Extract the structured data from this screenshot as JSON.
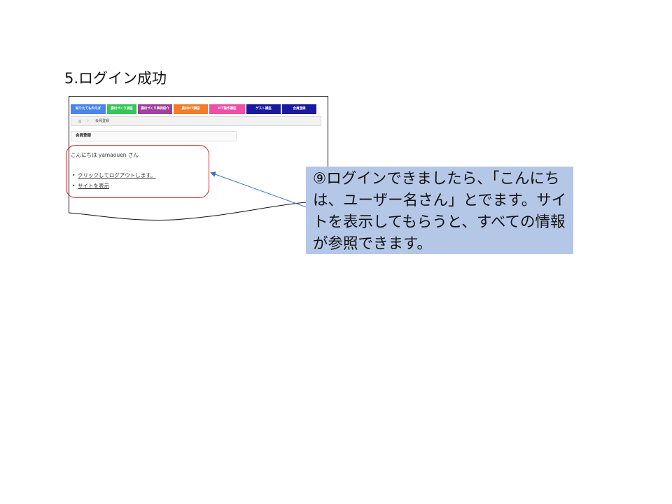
{
  "slide": {
    "title": "5.ログイン成功"
  },
  "screenshot": {
    "nav_tabs": [
      {
        "label": "知りたてものえば",
        "color": "#4a86e8"
      },
      {
        "label": "農村づくり講座",
        "color": "#34c759"
      },
      {
        "label": "農村づくり事例紹介",
        "color": "#a0419b"
      },
      {
        "label": "農村ICT講座",
        "color": "#f57c26"
      },
      {
        "label": "ICT操作講座",
        "color": "#ef4fa6"
      },
      {
        "label": "ゲスト講座",
        "color": "#1a1aa0"
      },
      {
        "label": "会員登録",
        "color": "#1a1aa0"
      }
    ],
    "breadcrumb": {
      "home_icon": "home-icon",
      "current": "会員登録"
    },
    "section_title": "会員登録",
    "greeting": "こんにちは yamaouen さん",
    "links": [
      {
        "label": "クリックしてログアウトします。"
      },
      {
        "label": "サイトを表示"
      }
    ]
  },
  "callout": {
    "text": "⑨ログインできましたら、「こんにちは、ユーザー名さん」とでます。サイトを表示してもらうと、すべての情報が参照できます。"
  },
  "colors": {
    "highlight": "#e02020",
    "callout_bg": "#b4c7e7",
    "arrow": "#4472c4"
  }
}
